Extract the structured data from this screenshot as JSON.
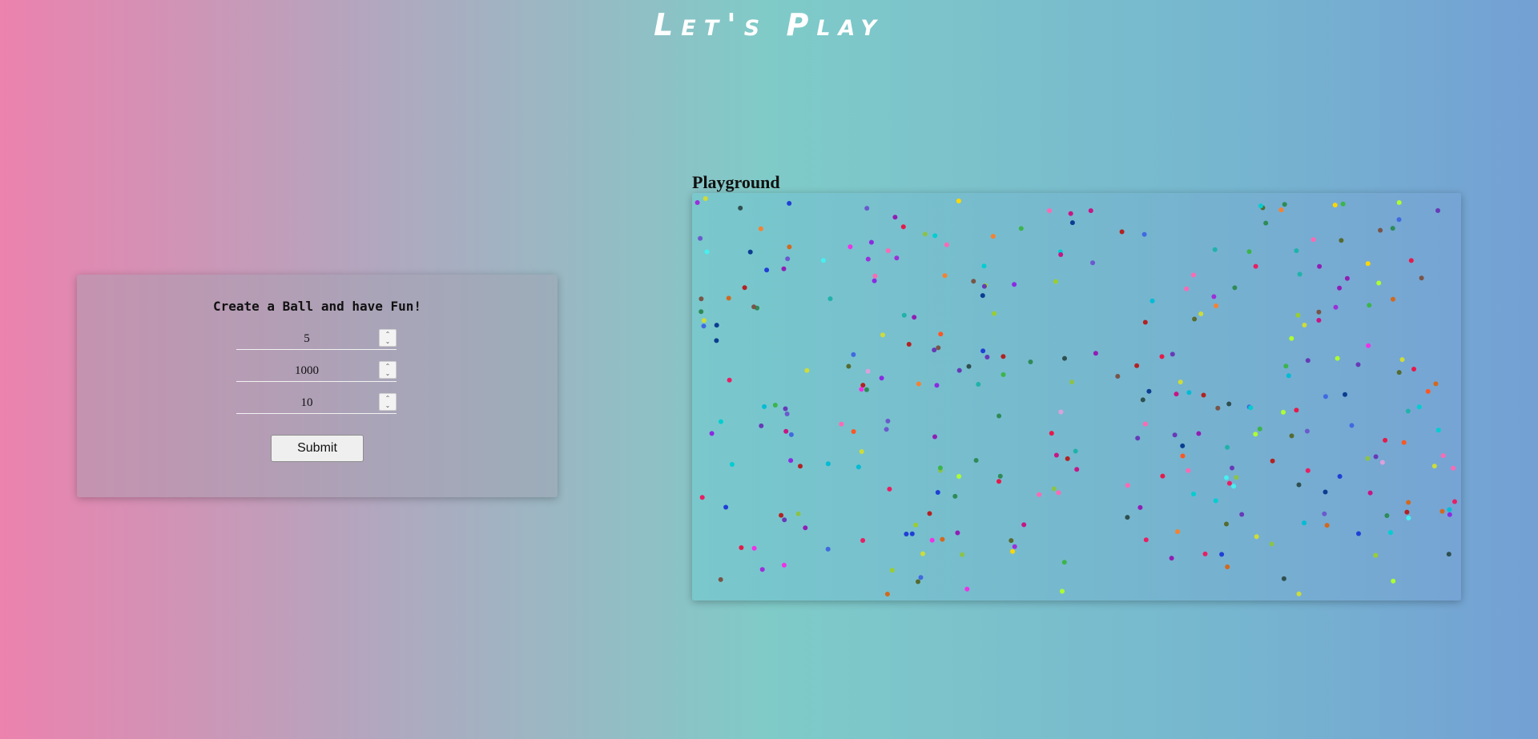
{
  "header": {
    "title": "Let's Play"
  },
  "form": {
    "heading": "Create a Ball and have Fun!",
    "fields": [
      {
        "value": "5"
      },
      {
        "value": "1000"
      },
      {
        "value": "10"
      }
    ],
    "submit_label": "Submit"
  },
  "playground": {
    "title": "Playground"
  }
}
